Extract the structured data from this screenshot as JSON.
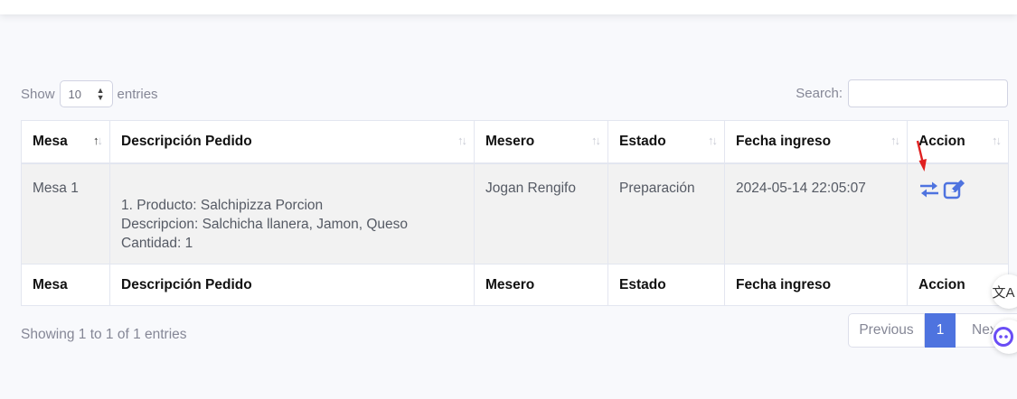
{
  "length_menu": {
    "show_label": "Show",
    "selected": "10",
    "entries_label": "entries"
  },
  "search": {
    "label": "Search:",
    "value": ""
  },
  "table": {
    "headers": [
      "Mesa",
      "Descripción Pedido",
      "Mesero",
      "Estado",
      "Fecha ingreso",
      "Accion"
    ],
    "rows": [
      {
        "mesa": "Mesa 1",
        "descripcion": [
          "1. Producto: Salchipizza Porcion",
          "Descripcion: Salchicha llanera, Jamon, Queso",
          "Cantidad: 1"
        ],
        "mesero": "Jogan Rengifo",
        "estado": "Preparación",
        "fecha": "2024-05-14 22:05:07"
      }
    ],
    "footers": [
      "Mesa",
      "Descripción Pedido",
      "Mesero",
      "Estado",
      "Fecha ingreso",
      "Accion"
    ]
  },
  "info_text": "Showing 1 to 1 of 1 entries",
  "pagination": {
    "previous": "Previous",
    "current": "1",
    "next": "Next"
  },
  "colors": {
    "accent": "#4e73df",
    "marker": "#e02020"
  },
  "icons": [
    "exchange-icon",
    "edit-icon",
    "translate-icon",
    "assistant-icon"
  ]
}
